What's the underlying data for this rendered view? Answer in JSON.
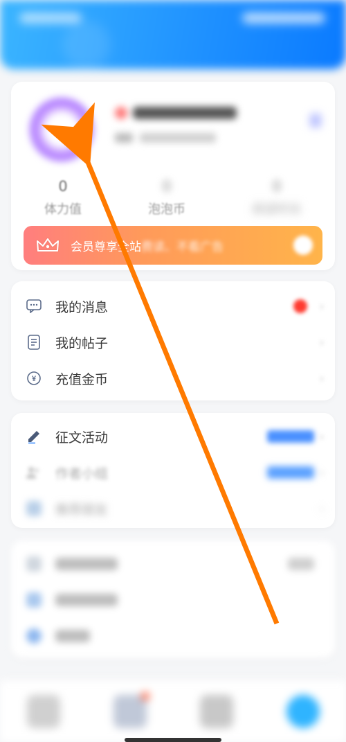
{
  "stats": {
    "stamina": {
      "value": "0",
      "label": "体力值"
    },
    "coin": {
      "value": "0",
      "label": "泡泡币"
    },
    "third": {
      "value": "0",
      "label": "阅读时长"
    }
  },
  "vip": {
    "text_clear": "会员尊享全站",
    "text_blur": "费读、不看广告"
  },
  "list1": {
    "messages": "我的消息",
    "posts": "我的帖子",
    "recharge": "充值金币"
  },
  "list2": {
    "essay": "征文活动",
    "author": "作者小组",
    "third": "推荐朋友"
  },
  "colors": {
    "accent": "#1e90ff",
    "arrow": "#ff7a00"
  }
}
